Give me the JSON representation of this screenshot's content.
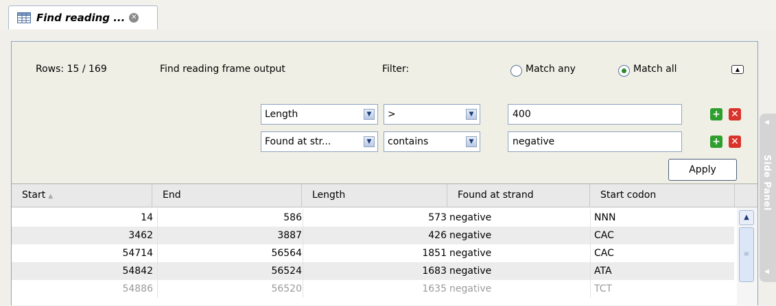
{
  "tab": {
    "title": "Find reading ...",
    "icon": "table-icon",
    "close_icon": "close-icon"
  },
  "filter": {
    "rows_label": "Rows: 15 / 169",
    "table_name": "Find reading frame output",
    "filter_label": "Filter:",
    "match_any_label": "Match any",
    "match_all_label": "Match all",
    "match_selected": "Match all",
    "rules": [
      {
        "field": "Length",
        "operator": ">",
        "value": "400"
      },
      {
        "field": "Found at str...",
        "operator": "contains",
        "value": "negative"
      }
    ],
    "apply_label": "Apply"
  },
  "table": {
    "columns": [
      "Start",
      "End",
      "Length",
      "Found at strand",
      "Start codon"
    ],
    "sort_column": "Start",
    "rows": [
      {
        "start": "14",
        "end": "586",
        "length": "573",
        "strand": "negative",
        "codon": "NNN"
      },
      {
        "start": "3462",
        "end": "3887",
        "length": "426",
        "strand": "negative",
        "codon": "CAC"
      },
      {
        "start": "54714",
        "end": "56564",
        "length": "1851",
        "strand": "negative",
        "codon": "CAC"
      },
      {
        "start": "54842",
        "end": "56524",
        "length": "1683",
        "strand": "negative",
        "codon": "ATA"
      },
      {
        "start": "54886",
        "end": "56520",
        "length": "1635",
        "strand": "negative",
        "codon": "TCT"
      }
    ]
  },
  "side_panel": {
    "label": "Side Panel"
  }
}
